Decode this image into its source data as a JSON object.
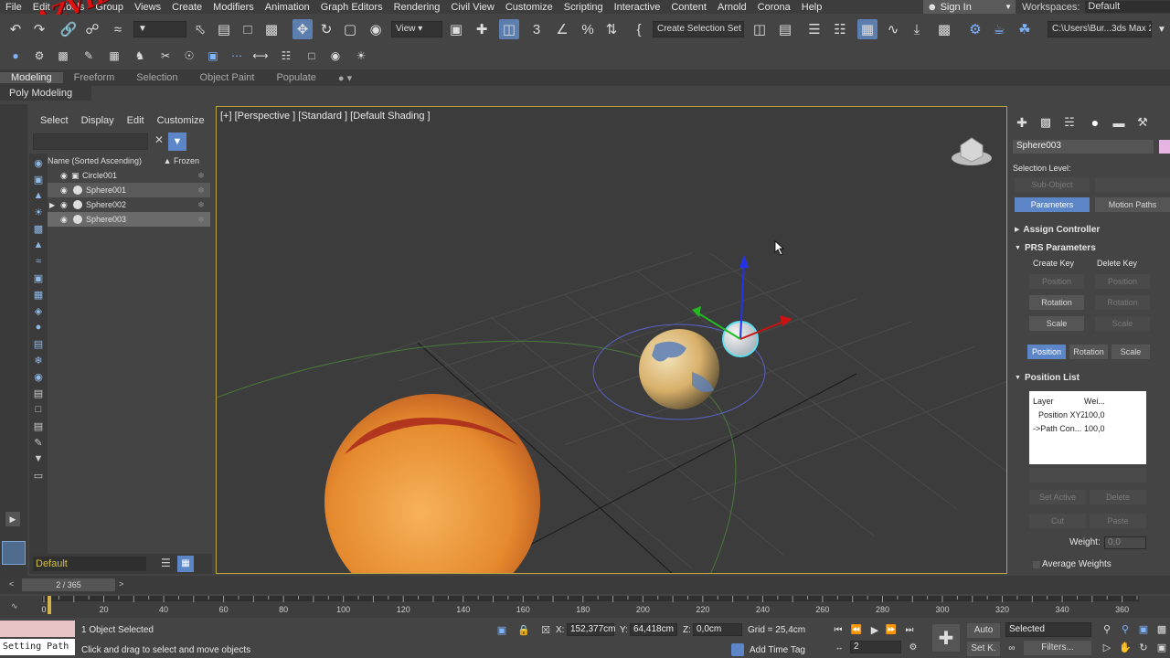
{
  "menubar": {
    "items": [
      "File",
      "Edit",
      "Tools",
      "Group",
      "Views",
      "Create",
      "Modifiers",
      "Animation",
      "Graph Editors",
      "Rendering",
      "Civil View",
      "Customize",
      "Scripting",
      "Interactive",
      "Content",
      "Arnold",
      "Corona",
      "Help"
    ],
    "sign_in": "Sign In",
    "workspaces_label": "Workspaces:",
    "workspace_value": "Default"
  },
  "watermark": "RAZVIDASHKI",
  "toolbar": {
    "view_dropdown": "View",
    "selection_set": "Create Selection Set",
    "project_path": "C:\\Users\\Bur...3ds Max 2020"
  },
  "ribbon": {
    "tabs": [
      "Modeling",
      "Freeform",
      "Selection",
      "Object Paint",
      "Populate"
    ],
    "sub_label": "Poly Modeling"
  },
  "explorer": {
    "tabs": [
      "Select",
      "Display",
      "Edit",
      "Customize"
    ],
    "header_name": "Name (Sorted Ascending)",
    "header_frozen": "Frozen",
    "rows": [
      "Circle001",
      "Sphere001",
      "Sphere002",
      "Sphere003"
    ],
    "layer": "Default"
  },
  "viewport": {
    "label": "[+] [Perspective ] [Standard ] [Default Shading ]"
  },
  "command_panel": {
    "object_name": "Sphere003",
    "selection_level": "Selection Level:",
    "sub_object": "Sub-Object",
    "parameters": "Parameters",
    "motion_paths": "Motion Paths",
    "assign_controller": "Assign Controller",
    "prs_parameters": "PRS Parameters",
    "create_key": "Create Key",
    "delete_key": "Delete Key",
    "position": "Position",
    "rotation": "Rotation",
    "scale": "Scale",
    "position_list": "Position List",
    "list_header_layer": "Layer",
    "list_header_weight": "Wei...",
    "list_rows": [
      {
        "name": "Position XYZ",
        "weight": "100,0"
      },
      {
        "name": "->Path Con...",
        "weight": "100,0"
      }
    ],
    "set_active": "Set Active",
    "delete": "Delete",
    "cut": "Cut",
    "paste": "Paste",
    "weight_label": "Weight:",
    "weight_value": "0,0",
    "average_weights": "Average Weights"
  },
  "timeslider": {
    "frame": "2 / 365"
  },
  "timeline": {
    "ticks": [
      "0",
      "20",
      "40",
      "60",
      "80",
      "100",
      "120",
      "140",
      "160",
      "180",
      "200",
      "220",
      "240",
      "260",
      "280",
      "300",
      "320",
      "340",
      "360"
    ]
  },
  "status": {
    "script_label": "Setting Path",
    "selected": "1 Object Selected",
    "hint": "Click and drag to select and move objects",
    "x_label": "X:",
    "x_value": "152,377cm",
    "y_label": "Y:",
    "y_value": "64,418cm",
    "z_label": "Z:",
    "z_value": "0,0cm",
    "grid": "Grid = 25,4cm",
    "add_time_tag": "Add Time Tag",
    "auto": "Auto",
    "selected_dd": "Selected",
    "set_key": "Set K.",
    "filters": "Filters...",
    "frame_field": "2"
  }
}
